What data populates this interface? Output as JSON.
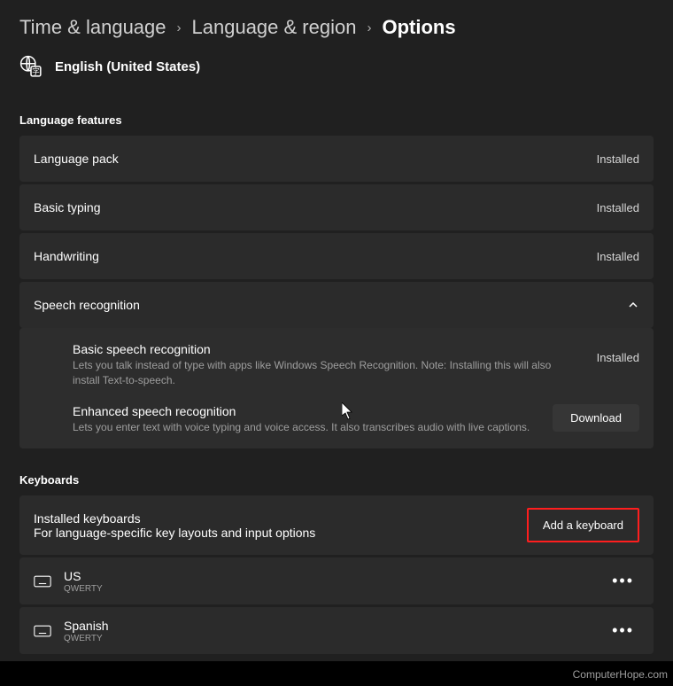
{
  "breadcrumb": {
    "level1": "Time & language",
    "level2": "Language & region",
    "current": "Options"
  },
  "language": {
    "name": "English (United States)"
  },
  "sections": {
    "features_title": "Language features",
    "keyboards_title": "Keyboards"
  },
  "features": {
    "language_pack": {
      "label": "Language pack",
      "status": "Installed"
    },
    "basic_typing": {
      "label": "Basic typing",
      "status": "Installed"
    },
    "handwriting": {
      "label": "Handwriting",
      "status": "Installed"
    },
    "speech_recognition": {
      "label": "Speech recognition"
    }
  },
  "speech": {
    "basic": {
      "title": "Basic speech recognition",
      "desc": "Lets you talk instead of type with apps like Windows Speech Recognition. Note: Installing this will also install Text-to-speech.",
      "status": "Installed"
    },
    "enhanced": {
      "title": "Enhanced speech recognition",
      "desc": "Lets you enter text with voice typing and voice access. It also transcribes audio with live captions.",
      "button": "Download"
    }
  },
  "keyboards": {
    "installed": {
      "title": "Installed keyboards",
      "sub": "For language-specific key layouts and input options",
      "add_button": "Add a keyboard"
    },
    "items": [
      {
        "name": "US",
        "layout": "QWERTY"
      },
      {
        "name": "Spanish",
        "layout": "QWERTY"
      }
    ]
  },
  "watermark": "ComputerHope.com"
}
